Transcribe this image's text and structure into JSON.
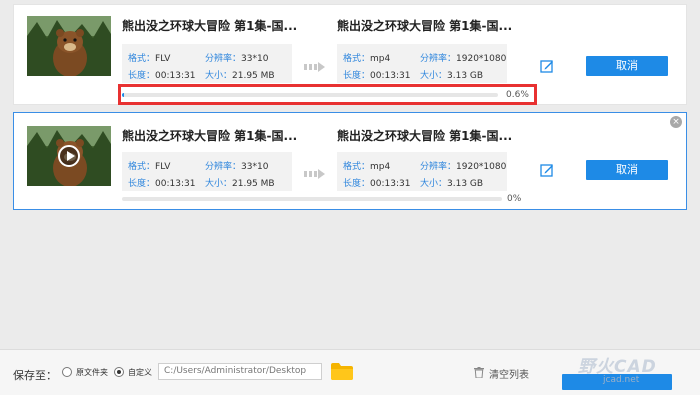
{
  "tasks": [
    {
      "source_title": "熊出没之环球大冒险 第1集-国...",
      "source": {
        "format_label": "格式：",
        "format": "FLV",
        "resolution_label": "分辨率：",
        "resolution": "33*10",
        "duration_label": "长度：",
        "duration": "00:13:31",
        "size_label": "大小：",
        "size": "21.95 MB"
      },
      "output_title": "熊出没之环球大冒险 第1集-国...",
      "output": {
        "format_label": "格式：",
        "format": "mp4",
        "resolution_label": "分辨率：",
        "resolution": "1920*1080",
        "duration_label": "长度：",
        "duration": "00:13:31",
        "size_label": "大小：",
        "size": "3.13 GB"
      },
      "cancel_label": "取消",
      "progress_text": "0.6%",
      "progress_value": 0.006,
      "selected": false
    },
    {
      "source_title": "熊出没之环球大冒险 第1集-国...",
      "source": {
        "format_label": "格式：",
        "format": "FLV",
        "resolution_label": "分辨率：",
        "resolution": "33*10",
        "duration_label": "长度：",
        "duration": "00:13:31",
        "size_label": "大小：",
        "size": "21.95 MB"
      },
      "output_title": "熊出没之环球大冒险 第1集-国...",
      "output": {
        "format_label": "格式：",
        "format": "mp4",
        "resolution_label": "分辨率：",
        "resolution": "1920*1080",
        "duration_label": "长度：",
        "duration": "00:13:31",
        "size_label": "大小：",
        "size": "3.13 GB"
      },
      "cancel_label": "取消",
      "progress_text": "0%",
      "progress_value": 0,
      "selected": true,
      "close_glyph": "×"
    }
  ],
  "footer": {
    "save_label": "保存至：",
    "option_source": "原文件夹",
    "option_custom": "自定义",
    "selected_option": "自定义",
    "path_value": "C:/Users/Administrator/Desktop",
    "clear_label": "清空列表"
  },
  "watermark": {
    "brand": "野火CAD",
    "url": "jcad.net"
  },
  "colors": {
    "accent": "#1e8ae6",
    "label_blue": "#2f86dd",
    "highlight_red": "#e83131"
  },
  "icons": {
    "edit": "edit-icon",
    "play": "play-icon",
    "close": "close-icon",
    "folder": "folder-icon",
    "trash": "trash-icon",
    "arrow": "convert-arrow-icon"
  }
}
